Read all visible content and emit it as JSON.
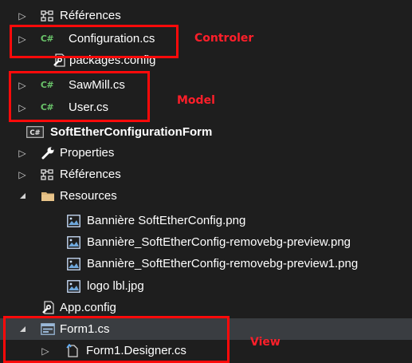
{
  "tree": {
    "items": [
      {
        "label": "Références",
        "icon": "references-icon"
      },
      {
        "label": "Configuration.cs",
        "icon": "csharp-file-icon"
      },
      {
        "label": "packages.config",
        "icon": "config-file-icon"
      },
      {
        "label": "SawMill.cs",
        "icon": "csharp-file-icon"
      },
      {
        "label": "User.cs",
        "icon": "csharp-file-icon"
      },
      {
        "label": "SoftEtherConfigurationForm",
        "icon": "csharp-project-icon"
      },
      {
        "label": "Properties",
        "icon": "wrench-icon"
      },
      {
        "label": "Références",
        "icon": "references-icon"
      },
      {
        "label": "Resources",
        "icon": "folder-icon"
      },
      {
        "label": "Bannière SoftEtherConfig.png",
        "icon": "image-file-icon"
      },
      {
        "label": "Bannière_SoftEtherConfig-removebg-preview.png",
        "icon": "image-file-icon"
      },
      {
        "label": "Bannière_SoftEtherConfig-removebg-preview1.png",
        "icon": "image-file-icon"
      },
      {
        "label": "logo lbl.jpg",
        "icon": "image-file-icon"
      },
      {
        "label": "App.config",
        "icon": "config-file-icon"
      },
      {
        "label": "Form1.cs",
        "icon": "form-file-icon"
      },
      {
        "label": "Form1.Designer.cs",
        "icon": "designer-file-icon"
      }
    ],
    "csharp_badge": "C#",
    "project_badge": "C#"
  },
  "annotations": {
    "controler": "Controler",
    "model": "Model",
    "view": "View"
  },
  "colors": {
    "background": "#1e1e1e",
    "selected_row": "#3a3d41",
    "annotation_red": "#ff0a0a",
    "csharp_green": "#6ac46a"
  }
}
